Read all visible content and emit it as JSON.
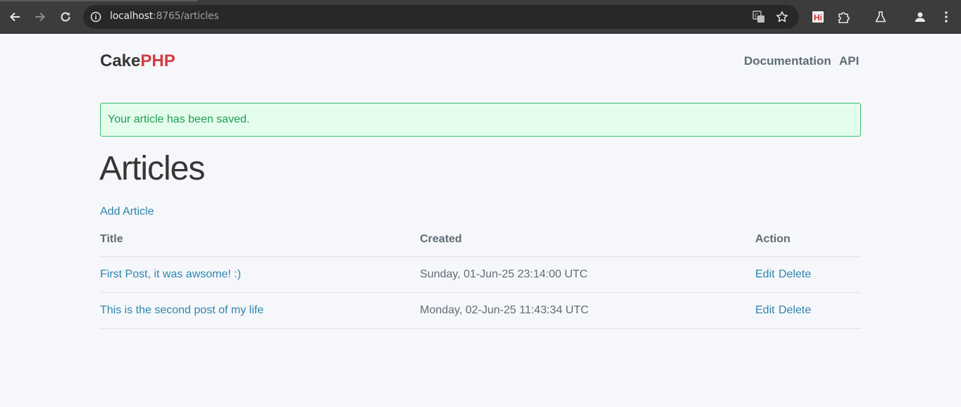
{
  "browser": {
    "url_host": "localhost",
    "url_rest": ":8765/articles"
  },
  "header": {
    "brand_cake": "Cake",
    "brand_php": "PHP",
    "nav": [
      "Documentation",
      "API"
    ]
  },
  "flash": {
    "message": "Your article has been saved."
  },
  "main": {
    "title": "Articles",
    "add_label": "Add Article",
    "columns": [
      "Title",
      "Created",
      "Action"
    ],
    "rows": [
      {
        "title": "First Post, it was awsome! :)",
        "created": "Sunday, 01-Jun-25 23:14:00 UTC",
        "edit": "Edit",
        "delete": "Delete"
      },
      {
        "title": "This is the second post of my life",
        "created": "Monday, 02-Jun-25 11:43:34 UTC",
        "edit": "Edit",
        "delete": "Delete"
      }
    ]
  },
  "colors": {
    "link": "#2f85ae",
    "brand_accent": "#d33c43",
    "flash_bg": "#e3fcec",
    "flash_text": "#1f9d55"
  },
  "icons": [
    "back-icon",
    "forward-icon",
    "reload-icon",
    "site-info-icon",
    "translate-icon",
    "bookmark-star-icon",
    "hi-extension-icon",
    "extensions-puzzle-icon",
    "labs-flask-icon",
    "profile-icon",
    "menu-kebab-icon"
  ]
}
